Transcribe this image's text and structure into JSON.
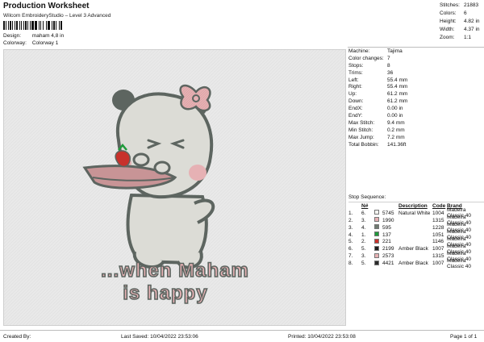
{
  "header": {
    "title": "Production Worksheet",
    "subtitle": "Wilcom EmbroideryStudio – Level 3 Advanced",
    "design_label": "Design:",
    "design_value": "maham 4,8 in",
    "colorway_label": "Colorway:",
    "colorway_value": "Colorway 1"
  },
  "summary": [
    {
      "k": "Stitches:",
      "v": "21883"
    },
    {
      "k": "Colors:",
      "v": "6"
    },
    {
      "k": "Height:",
      "v": "4.82 in"
    },
    {
      "k": "Width:",
      "v": "4.37 in"
    },
    {
      "k": "Zoom:",
      "v": "1:1"
    }
  ],
  "machine_info": [
    {
      "k": "Machine:",
      "v": "Tajima"
    },
    {
      "k": "Color changes:",
      "v": "7"
    },
    {
      "k": "Stops:",
      "v": "8"
    },
    {
      "k": "Trims:",
      "v": "36"
    },
    {
      "k": "Left:",
      "v": "55.4 mm"
    },
    {
      "k": "Right:",
      "v": "55.4 mm"
    },
    {
      "k": "Up:",
      "v": "61.2 mm"
    },
    {
      "k": "Down:",
      "v": "61.2 mm"
    },
    {
      "k": "EndX:",
      "v": "0.00 in"
    },
    {
      "k": "EndY:",
      "v": "0.00 in"
    },
    {
      "k": "Max Stitch:",
      "v": "9.4 mm"
    },
    {
      "k": "Min Stitch:",
      "v": "0.2 mm"
    },
    {
      "k": "Max Jump:",
      "v": "7.2 mm"
    },
    {
      "k": "Total Bobbin:",
      "v": "141.36ft"
    }
  ],
  "stop_sequence": {
    "title": "Stop Sequence:",
    "headers": {
      "n": "N#",
      "desc": "Description",
      "code": "Code",
      "brand": "Brand"
    },
    "rows": [
      {
        "stop": "1.",
        "n": "6.",
        "color": "#f4f4f0",
        "num": "5745",
        "desc": "Natural White",
        "code": "1004",
        "brand": "Madeira Classic 40"
      },
      {
        "stop": "2.",
        "n": "3.",
        "color": "#e6b1b4",
        "num": "1990",
        "desc": "",
        "code": "1315",
        "brand": "Madeira Classic 40"
      },
      {
        "stop": "3.",
        "n": "4.",
        "color": "#6f7a70",
        "num": "595",
        "desc": "",
        "code": "1228",
        "brand": "Madeira Classic 40"
      },
      {
        "stop": "4.",
        "n": "1.",
        "color": "#1f9a3a",
        "num": "137",
        "desc": "",
        "code": "1051",
        "brand": "Madeira Classic 40"
      },
      {
        "stop": "5.",
        "n": "2.",
        "color": "#c8312c",
        "num": "221",
        "desc": "",
        "code": "1146",
        "brand": "Madeira Classic 40"
      },
      {
        "stop": "6.",
        "n": "5.",
        "color": "#1d1d1d",
        "num": "2199",
        "desc": "Amber Black",
        "code": "1007",
        "brand": "Madeira Classic 40"
      },
      {
        "stop": "7.",
        "n": "3.",
        "color": "#e6b1b4",
        "num": "2573",
        "desc": "",
        "code": "1315",
        "brand": "Madeira Classic 40"
      },
      {
        "stop": "8.",
        "n": "5.",
        "color": "#2a2a2a",
        "num": "4421",
        "desc": "Amber Black",
        "code": "1007",
        "brand": "Madeira Classic 40"
      }
    ]
  },
  "design_text": {
    "line1": "...when Maham",
    "line2": "is happy"
  },
  "footer": {
    "created_by": "Created By:",
    "last_saved": "Last Saved: 10/04/2022 23:53:06",
    "printed": "Printed: 10/04/2022 23:53:08",
    "page": "Page 1 of 1"
  },
  "colors": {
    "fabric": "#e9e9e9",
    "body": "#dcdcd6",
    "outline": "#5d6560",
    "pink": "#e6b1b4",
    "red": "#c8312c",
    "green": "#1f9a3a"
  }
}
